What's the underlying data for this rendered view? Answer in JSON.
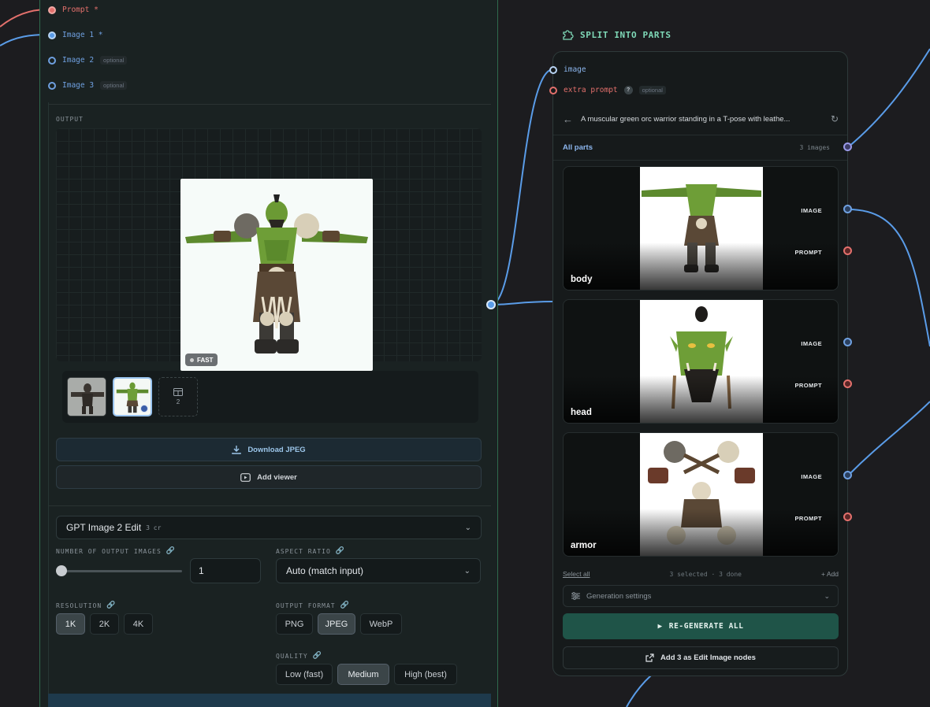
{
  "left_node": {
    "inputs": [
      {
        "label": "Prompt",
        "required_mark": "*",
        "color": "#e3706c",
        "connected": true
      },
      {
        "label": "Image 1",
        "required_mark": "*",
        "color": "#6fa0e0",
        "connected": true
      },
      {
        "label": "Image 2",
        "tag": "optional",
        "color": "#6fa0e0",
        "connected": false
      },
      {
        "label": "Image 3",
        "tag": "optional",
        "color": "#6fa0e0",
        "connected": false
      }
    ],
    "output_label": "OUTPUT",
    "fast_badge": "FAST",
    "thumb_more_count": "2",
    "download_label": "Download JPEG",
    "add_viewer_label": "Add viewer"
  },
  "settings": {
    "model": "GPT Image 2 Edit",
    "model_cost": "3 cr",
    "num_images_label": "NUMBER OF OUTPUT IMAGES",
    "num_images_value": "1",
    "num_images_slider": 0,
    "aspect_label": "ASPECT RATIO",
    "aspect_value": "Auto (match input)",
    "resolution_label": "RESOLUTION",
    "resolution_options": [
      "1K",
      "2K",
      "4K"
    ],
    "resolution_selected": "1K",
    "format_label": "OUTPUT FORMAT",
    "format_options": [
      "PNG",
      "JPEG",
      "WebP"
    ],
    "format_selected": "JPEG",
    "quality_label": "QUALITY",
    "quality_options": [
      "Low (fast)",
      "Medium",
      "High (best)"
    ],
    "quality_selected": "Medium"
  },
  "split_node": {
    "title": "SPLIT INTO PARTS",
    "inputs": {
      "image": "image",
      "extra_prompt": "extra prompt",
      "help": "?",
      "optional": "optional"
    },
    "prompt_text": "A muscular green orc warrior standing in a T-pose with leathe...",
    "parts_header": "All parts",
    "parts_count": "3 images",
    "parts": [
      {
        "name": "body",
        "out_image": "IMAGE",
        "out_prompt": "PROMPT"
      },
      {
        "name": "head",
        "out_image": "IMAGE",
        "out_prompt": "PROMPT"
      },
      {
        "name": "armor",
        "out_image": "IMAGE",
        "out_prompt": "PROMPT"
      }
    ],
    "select_all": "Select all",
    "selection_status": "3 selected · 3 done",
    "add_label": "Add",
    "generation_settings": "Generation settings",
    "regenerate_label": "RE-GENERATE ALL",
    "edit_nodes_label": "Add 3 as Edit Image nodes"
  },
  "colors": {
    "accent_green": "#7fd9b8",
    "wire_blue": "#5a9ce8",
    "port_red": "#e3706c",
    "regen_bg": "#1f5448"
  }
}
